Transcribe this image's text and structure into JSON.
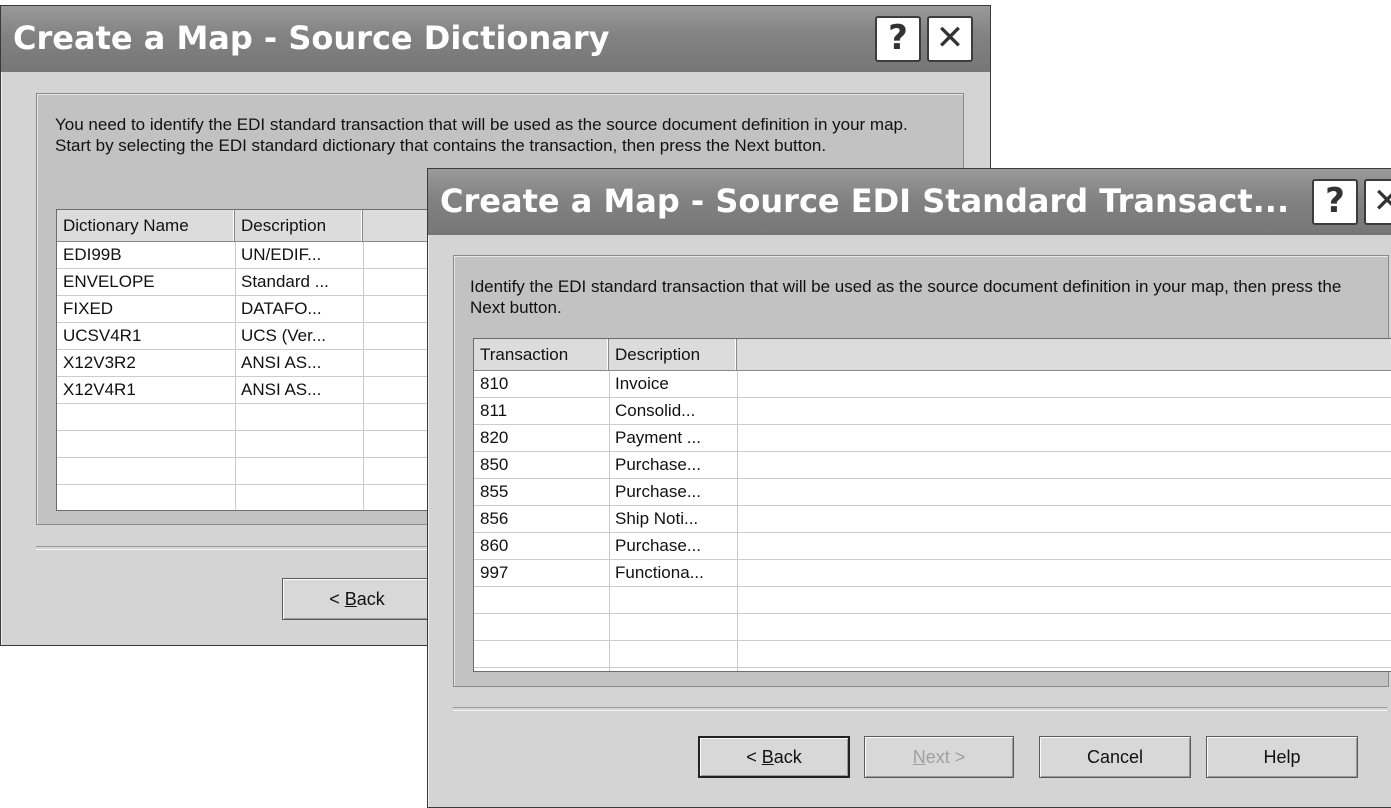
{
  "dialog1": {
    "title": "Create a Map - Source Dictionary",
    "intro": "You need to identify the EDI standard transaction that will be used as the source document definition in your map.  Start by selecting the EDI standard dictionary that contains the transaction, then press the Next button.",
    "columns": [
      "Dictionary Name",
      "Description"
    ],
    "rows": [
      [
        "EDI99B",
        "UN/EDIF..."
      ],
      [
        "ENVELOPE",
        "Standard ..."
      ],
      [
        "FIXED",
        "DATAFO..."
      ],
      [
        "UCSV4R1",
        "UCS (Ver..."
      ],
      [
        "X12V3R2",
        "ANSI AS..."
      ],
      [
        "X12V4R1",
        "ANSI AS..."
      ]
    ],
    "back_button": {
      "pre": "< ",
      "key": "B",
      "rest": "ack"
    }
  },
  "dialog2": {
    "title": "Create a Map - Source EDI Standard Transact...",
    "intro": "Identify the EDI standard transaction that will be used as the source document definition in your map, then press the Next button.",
    "columns": [
      "Transaction",
      "Description"
    ],
    "rows": [
      [
        "810",
        "Invoice"
      ],
      [
        "811",
        "Consolid..."
      ],
      [
        "820",
        "Payment ..."
      ],
      [
        "850",
        "Purchase..."
      ],
      [
        "855",
        "Purchase..."
      ],
      [
        "856",
        "Ship Noti..."
      ],
      [
        "860",
        "Purchase..."
      ],
      [
        "997",
        "Functiona..."
      ]
    ],
    "back_button": {
      "pre": "< ",
      "key": "B",
      "rest": "ack"
    },
    "next_button": {
      "key": "N",
      "rest": "ext >"
    },
    "cancel_label": "Cancel",
    "help_label": "Help"
  },
  "title_buttons": {
    "help_glyph": "?",
    "close_glyph": "✕"
  },
  "icons": [
    "help-icon",
    "close-icon"
  ]
}
